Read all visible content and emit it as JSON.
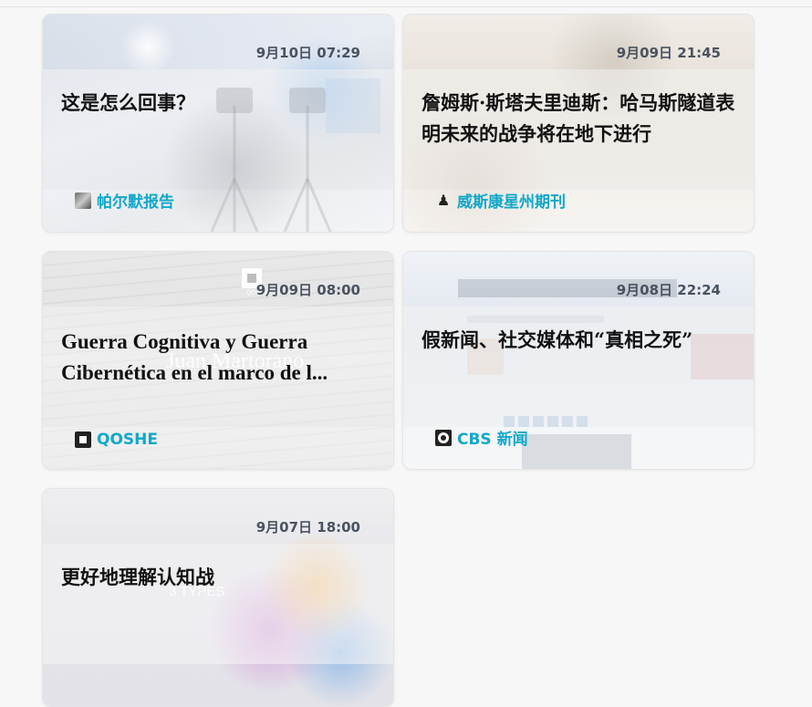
{
  "cards": [
    {
      "time": "9月10日 07:29",
      "title": "这是怎么回事？",
      "source": "帕尔默报告",
      "source_icon": "portrait-icon",
      "accent": "#11a8c9"
    },
    {
      "time": "9月09日 21:45",
      "title": "詹姆斯·斯塔夫里迪斯：哈马斯隧道表明未来的战争将在地下进行",
      "source": "威斯康星州期刊",
      "source_icon": "chess-pawn-icon",
      "accent": "#11a8c9"
    },
    {
      "time": "9月09日 08:00",
      "title": "Guerra Cognitiva y Guerra Cibernética en el marco de l...",
      "source": "QOSHE",
      "source_icon": "qoshe-logo-icon",
      "watermark": "Juan Martorano",
      "logo_caption": "QOSHE",
      "accent": "#11a8c9"
    },
    {
      "time": "9月08日 22:24",
      "title": "假新闻、社交媒体和“真相之死”",
      "source": "CBS 新闻",
      "source_icon": "cbs-eye-icon",
      "accent": "#11a8c9"
    },
    {
      "time": "9月07日 18:00",
      "title": "更好地理解认知战",
      "watermark": "3 TYPES",
      "accent": "#11a8c9"
    }
  ]
}
